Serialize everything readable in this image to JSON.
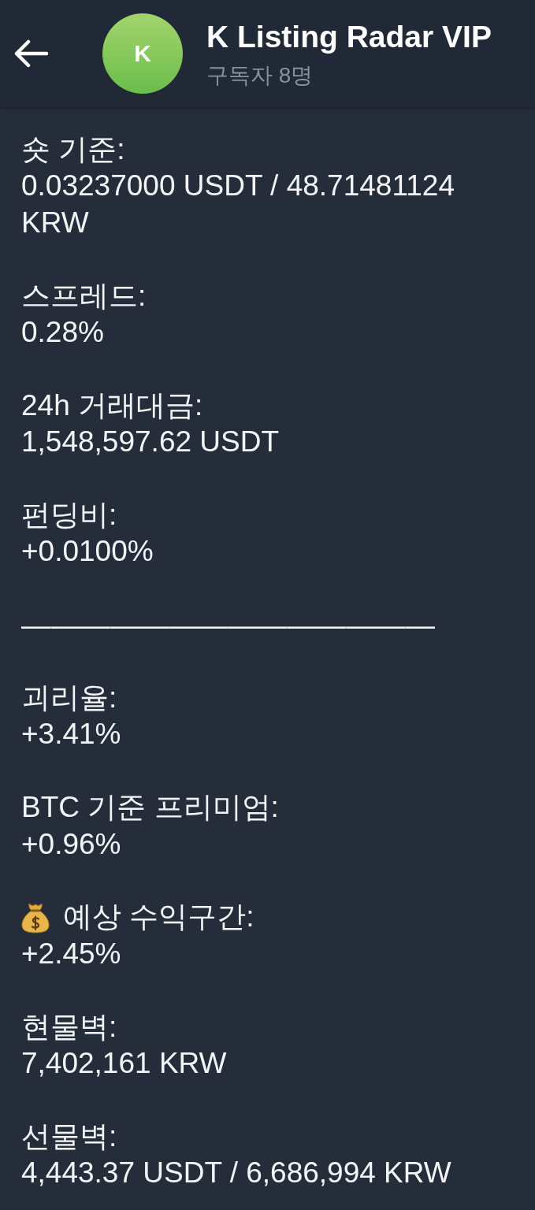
{
  "header": {
    "title": "K Listing Radar VIP",
    "subtitle": "구독자 8명",
    "avatar_initial": "K"
  },
  "message": {
    "blocks": [
      {
        "kind": "field",
        "label": "숏 기준:",
        "value": "0.03237000 USDT / 48.71481124 KRW"
      },
      {
        "kind": "field",
        "label": "스프레드:",
        "value": "0.28%"
      },
      {
        "kind": "field",
        "label": "24h 거래대금:",
        "value": "1,548,597.62 USDT"
      },
      {
        "kind": "field",
        "label": "펀딩비:",
        "value": "+0.0100%"
      },
      {
        "kind": "separator",
        "text": "——————————————"
      },
      {
        "kind": "field",
        "label": "괴리율:",
        "value": "+3.41%"
      },
      {
        "kind": "field",
        "label": "BTC 기준 프리미엄:",
        "value": "+0.96%"
      },
      {
        "kind": "iconfield",
        "label": "예상 수익구간:",
        "value": "+2.45%"
      },
      {
        "kind": "field",
        "label": "현물벽:",
        "value": "7,402,161 KRW"
      },
      {
        "kind": "field",
        "label": "선물벽:",
        "value": "4,443.37 USDT / 6,686,994 KRW"
      }
    ]
  }
}
